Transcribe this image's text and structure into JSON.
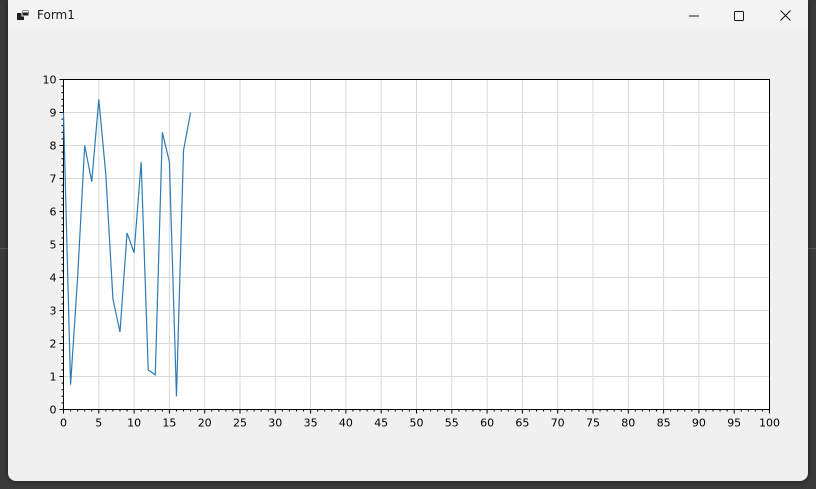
{
  "window": {
    "title": "Form1",
    "icon": "winforms-app-icon",
    "controls": {
      "minimize": "minimize-icon",
      "maximize": "maximize-icon",
      "close": "close-icon"
    }
  },
  "chart_data": {
    "type": "line",
    "title": "",
    "xlabel": "",
    "ylabel": "",
    "xlim": [
      0,
      100
    ],
    "ylim": [
      0,
      10
    ],
    "x_ticks": [
      0,
      5,
      10,
      15,
      20,
      25,
      30,
      35,
      40,
      45,
      50,
      55,
      60,
      65,
      70,
      75,
      80,
      85,
      90,
      95,
      100
    ],
    "y_ticks": [
      0,
      1,
      2,
      3,
      4,
      5,
      6,
      7,
      8,
      9,
      10
    ],
    "grid": true,
    "line_color": "#2e7bb5",
    "series": [
      {
        "x": [
          0,
          1,
          2,
          3,
          4,
          5,
          6,
          7,
          8,
          9,
          10,
          11,
          12,
          13,
          14,
          15,
          16,
          17,
          18
        ],
        "values": [
          9.0,
          0.75,
          4.0,
          8.0,
          6.9,
          9.4,
          7.1,
          3.35,
          2.35,
          5.35,
          4.75,
          7.5,
          1.2,
          1.05,
          8.4,
          7.5,
          0.4,
          7.85,
          9.0
        ]
      }
    ]
  }
}
